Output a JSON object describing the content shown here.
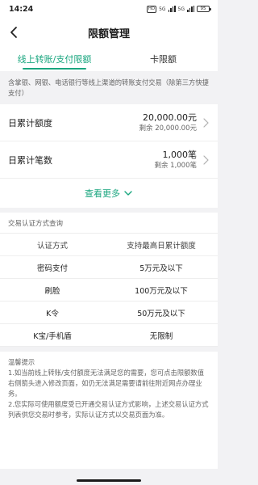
{
  "status_bar": {
    "time": "14:24",
    "network_1": "5G",
    "network_2": "5G",
    "battery": "95"
  },
  "nav": {
    "title": "限额管理"
  },
  "tabs": [
    {
      "label": "线上转账/支付限额",
      "active": true
    },
    {
      "label": "卡限额",
      "active": false
    }
  ],
  "description": "含掌银、网银、电话银行等线上渠道的转账支付交易（除第三方快捷支付）",
  "limits": [
    {
      "label": "日累计额度",
      "value": "20,000.00元",
      "remaining": "剩余 20,000.00元"
    },
    {
      "label": "日累计笔数",
      "value": "1,000笔",
      "remaining": "剩余 1,000笔"
    }
  ],
  "more_label": "查看更多",
  "auth_section": {
    "title": "交易认证方式查询",
    "headers": [
      "认证方式",
      "支持最高日累计额度"
    ],
    "rows": [
      [
        "密码支付",
        "5万元及以下"
      ],
      [
        "刷脸",
        "100万元及以下"
      ],
      [
        "K令",
        "50万元及以下"
      ],
      [
        "K宝/手机盾",
        "无限制"
      ]
    ]
  },
  "tips": {
    "title": "温馨提示",
    "lines": [
      "1.如当前线上转账/支付额度无法满足您的需要，您可点击限额数值右侧箭头进入修改页面，如仍无法满足需要请前往附近网点办理业务。",
      "2.您实际可使用额度受已开通交易认证方式影响，上述交易认证方式列表供您交易时参考，实际认证方式以交易页面为准。"
    ]
  },
  "colors": {
    "accent": "#1aa67f",
    "background": "#f2f2f4"
  }
}
